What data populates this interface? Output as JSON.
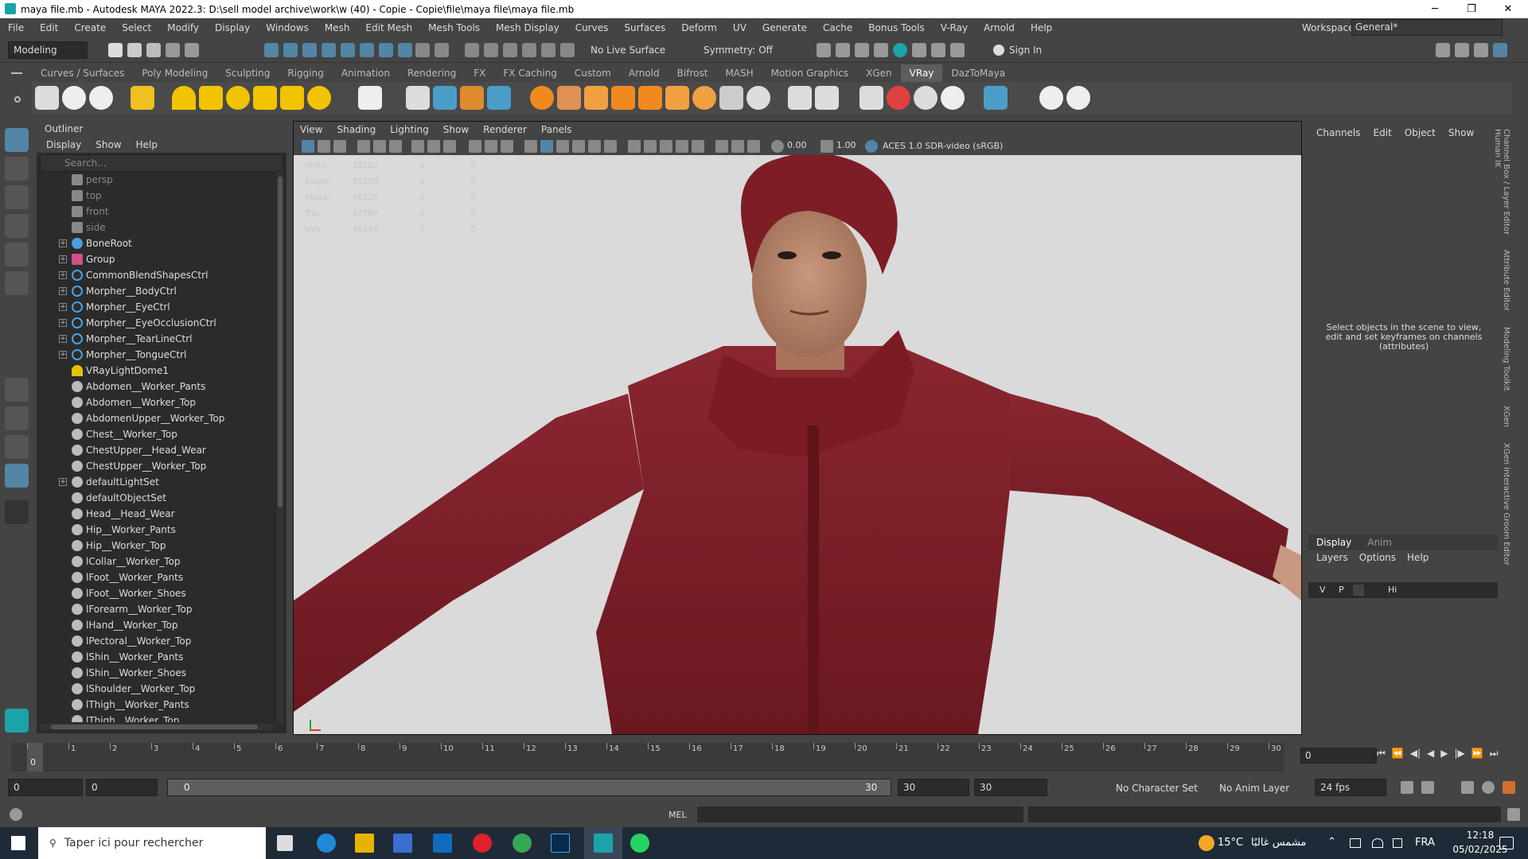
{
  "title_bar": {
    "title": "maya file.mb - Autodesk MAYA 2022.3: D:\\sell model archive\\work\\w (40) - Copie - Copie\\file\\maya file\\maya file.mb",
    "minimize": "─",
    "maximize": "❐",
    "close": "✕"
  },
  "menu": [
    "File",
    "Edit",
    "Create",
    "Select",
    "Modify",
    "Display",
    "Windows",
    "Mesh",
    "Edit Mesh",
    "Mesh Tools",
    "Mesh Display",
    "Curves",
    "Surfaces",
    "Deform",
    "UV",
    "Generate",
    "Cache",
    "Bonus Tools",
    "V-Ray",
    "Arnold",
    "Help"
  ],
  "workspace": {
    "label": "Workspace:",
    "value": "General*"
  },
  "status_line": {
    "mode": "Modeling",
    "live_surface": "No Live Surface",
    "symmetry": "Symmetry: Off",
    "sign_in": "Sign In"
  },
  "shelf_tabs": [
    "Curves / Surfaces",
    "Poly Modeling",
    "Sculpting",
    "Rigging",
    "Animation",
    "Rendering",
    "FX",
    "FX Caching",
    "Custom",
    "Arnold",
    "Bifrost",
    "MASH",
    "Motion Graphics",
    "XGen",
    "VRay",
    "DazToMaya"
  ],
  "active_shelf": "VRay",
  "outliner": {
    "title": "Outliner",
    "menu": [
      "Display",
      "Show",
      "Help"
    ],
    "search_placeholder": "Search...",
    "items": [
      {
        "label": "persp",
        "type": "camera"
      },
      {
        "label": "top",
        "type": "camera"
      },
      {
        "label": "front",
        "type": "camera"
      },
      {
        "label": "side",
        "type": "camera"
      },
      {
        "label": "BoneRoot",
        "type": "joint",
        "expand": true
      },
      {
        "label": "Group",
        "type": "group",
        "expand": true
      },
      {
        "label": "CommonBlendShapesCtrl",
        "type": "curve",
        "expand": true
      },
      {
        "label": "Morpher__BodyCtrl",
        "type": "curve",
        "expand": true
      },
      {
        "label": "Morpher__EyeCtrl",
        "type": "curve",
        "expand": true
      },
      {
        "label": "Morpher__EyeOcclusionCtrl",
        "type": "curve",
        "expand": true
      },
      {
        "label": "Morpher__TearLineCtrl",
        "type": "curve",
        "expand": true
      },
      {
        "label": "Morpher__TongueCtrl",
        "type": "curve",
        "expand": true
      },
      {
        "label": "VRayLightDome1",
        "type": "light"
      },
      {
        "label": "Abdomen__Worker_Pants",
        "type": "set"
      },
      {
        "label": "Abdomen__Worker_Top",
        "type": "set"
      },
      {
        "label": "AbdomenUpper__Worker_Top",
        "type": "set"
      },
      {
        "label": "Chest__Worker_Top",
        "type": "set"
      },
      {
        "label": "ChestUpper__Head_Wear",
        "type": "set"
      },
      {
        "label": "ChestUpper__Worker_Top",
        "type": "set"
      },
      {
        "label": "defaultLightSet",
        "type": "set",
        "expand": true
      },
      {
        "label": "defaultObjectSet",
        "type": "set"
      },
      {
        "label": "Head__Head_Wear",
        "type": "set"
      },
      {
        "label": "Hip__Worker_Pants",
        "type": "set"
      },
      {
        "label": "Hip__Worker_Top",
        "type": "set"
      },
      {
        "label": "lCollar__Worker_Top",
        "type": "set"
      },
      {
        "label": "lFoot__Worker_Pants",
        "type": "set"
      },
      {
        "label": "lFoot__Worker_Shoes",
        "type": "set"
      },
      {
        "label": "lForearm__Worker_Top",
        "type": "set"
      },
      {
        "label": "lHand__Worker_Top",
        "type": "set"
      },
      {
        "label": "lPectoral__Worker_Top",
        "type": "set"
      },
      {
        "label": "lShin__Worker_Pants",
        "type": "set"
      },
      {
        "label": "lShin__Worker_Shoes",
        "type": "set"
      },
      {
        "label": "lShoulder__Worker_Top",
        "type": "set"
      },
      {
        "label": "lThigh__Worker_Pants",
        "type": "set"
      },
      {
        "label": "lThigh__Worker_Top",
        "type": "set"
      }
    ]
  },
  "viewport": {
    "menu": [
      "View",
      "Shading",
      "Lighting",
      "Show",
      "Renderer",
      "Panels"
    ],
    "near_value": "0.00",
    "far_value": "1.00",
    "color_space": "ACES 1.0 SDR-video (sRGB)",
    "hud": [
      {
        "label": "Verts:",
        "a": "35102",
        "b": "0",
        "c": "0"
      },
      {
        "label": "Edges:",
        "a": "85238",
        "b": "0",
        "c": "0"
      },
      {
        "label": "Faces:",
        "a": "50226",
        "b": "0",
        "c": "0"
      },
      {
        "label": "Tris:",
        "a": "67509",
        "b": "0",
        "c": "0"
      },
      {
        "label": "UVs:",
        "a": "38148",
        "b": "0",
        "c": "0"
      }
    ]
  },
  "channel_box": {
    "menu": [
      "Channels",
      "Edit",
      "Object",
      "Show"
    ],
    "hint": "Select objects in the scene to view, edit and set keyframes on channels (attributes)",
    "side_tabs": [
      "Channel Box / Layer Editor",
      "Attribute Editor",
      "Modeling Toolkit",
      "XGen",
      "XGen Interactive Groom Editor",
      "Human IK"
    ]
  },
  "layer_editor": {
    "tabs": [
      "Display",
      "Anim"
    ],
    "menu": [
      "Layers",
      "Options",
      "Help"
    ],
    "columns": [
      "V",
      "P",
      "",
      "Hi"
    ]
  },
  "timeline": {
    "ticks": [
      "0",
      "1",
      "2",
      "3",
      "4",
      "5",
      "6",
      "7",
      "8",
      "9",
      "10",
      "11",
      "12",
      "13",
      "14",
      "15",
      "16",
      "17",
      "18",
      "19",
      "20",
      "21",
      "22",
      "23",
      "24",
      "25",
      "26",
      "27",
      "28",
      "29",
      "30"
    ],
    "current_frame": "0",
    "current_marker": "0"
  },
  "range": {
    "start": "0",
    "anim_start": "0",
    "slider_start": "0",
    "slider_end": "30",
    "end": "30",
    "anim_end": "30",
    "character_set": "No Character Set",
    "anim_layer": "No Anim Layer",
    "fps": "24 fps"
  },
  "cmdline": {
    "label": "MEL"
  },
  "taskbar": {
    "search": "Taper ici pour rechercher",
    "weather": "15°C",
    "weather_text": "مشمس غالبًا",
    "lang": "FRA",
    "time": "12:18",
    "date": "05/02/2025"
  },
  "colors": {
    "accent": "#5285a6",
    "maya_teal": "#1ba3a8",
    "robe": "#7a1c22"
  }
}
